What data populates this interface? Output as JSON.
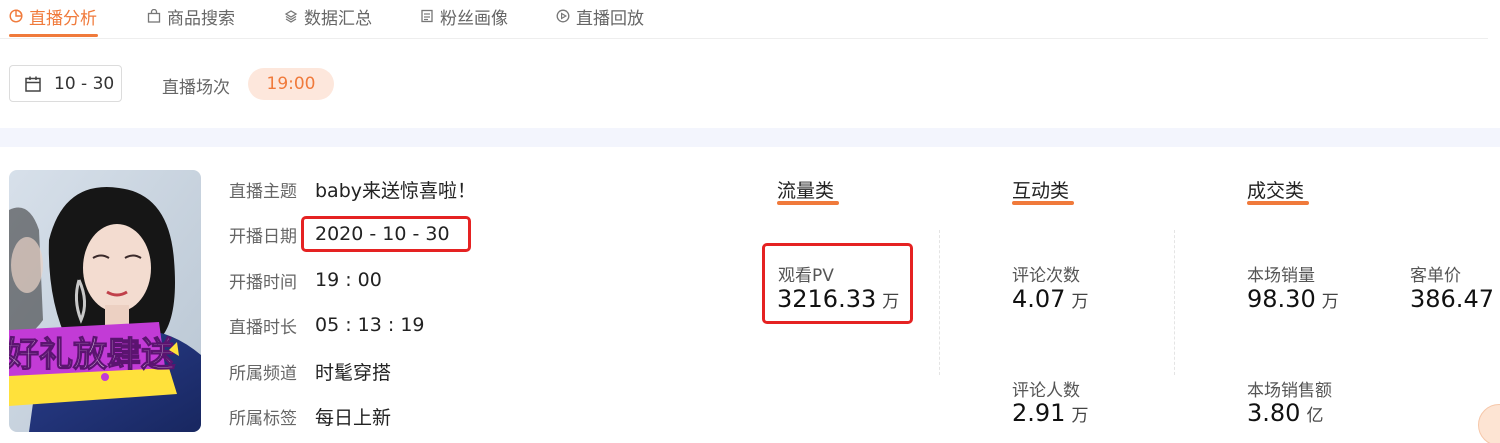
{
  "tabs": [
    {
      "label": "直播分析",
      "icon": "pie-chart-icon",
      "active": true
    },
    {
      "label": "商品搜索",
      "icon": "bag-icon",
      "active": false
    },
    {
      "label": "数据汇总",
      "icon": "database-icon",
      "active": false
    },
    {
      "label": "粉丝画像",
      "icon": "profile-card-icon",
      "active": false
    },
    {
      "label": "直播回放",
      "icon": "play-circle-icon",
      "active": false
    }
  ],
  "filter": {
    "date": "10 - 30",
    "session_label": "直播场次",
    "session_value": "19:00"
  },
  "cover": {
    "banner_text": "好礼放肆送"
  },
  "info": [
    {
      "label": "直播主题",
      "value": "baby来送惊喜啦！"
    },
    {
      "label": "开播日期",
      "value": "2020 - 10 - 30"
    },
    {
      "label": "开播时间",
      "value": "19 : 00"
    },
    {
      "label": "直播时长",
      "value": "05 : 13 : 19"
    },
    {
      "label": "所属频道",
      "value": "时髦穿搭"
    },
    {
      "label": "所属标签",
      "value": "每日上新"
    }
  ],
  "categories": {
    "traffic": {
      "title": "流量类",
      "metrics": [
        {
          "label": "观看PV",
          "value": "3216.33",
          "unit": "万"
        }
      ]
    },
    "interaction": {
      "title": "互动类",
      "metrics": [
        {
          "label": "评论次数",
          "value": "4.07",
          "unit": "万"
        },
        {
          "label": "评论人数",
          "value": "2.91",
          "unit": "万"
        }
      ]
    },
    "deal": {
      "title": "成交类",
      "metrics": [
        {
          "label": "本场销量",
          "value": "98.30",
          "unit": "万"
        },
        {
          "label": "客单价",
          "value": "386.47",
          "unit": ""
        },
        {
          "label": "本场销售额",
          "value": "3.80",
          "unit": "亿"
        }
      ]
    }
  },
  "colors": {
    "accent": "#f07a3b",
    "highlight_box": "#e52222",
    "band": "#f3f5fd",
    "pill_bg": "#fde7dc"
  }
}
